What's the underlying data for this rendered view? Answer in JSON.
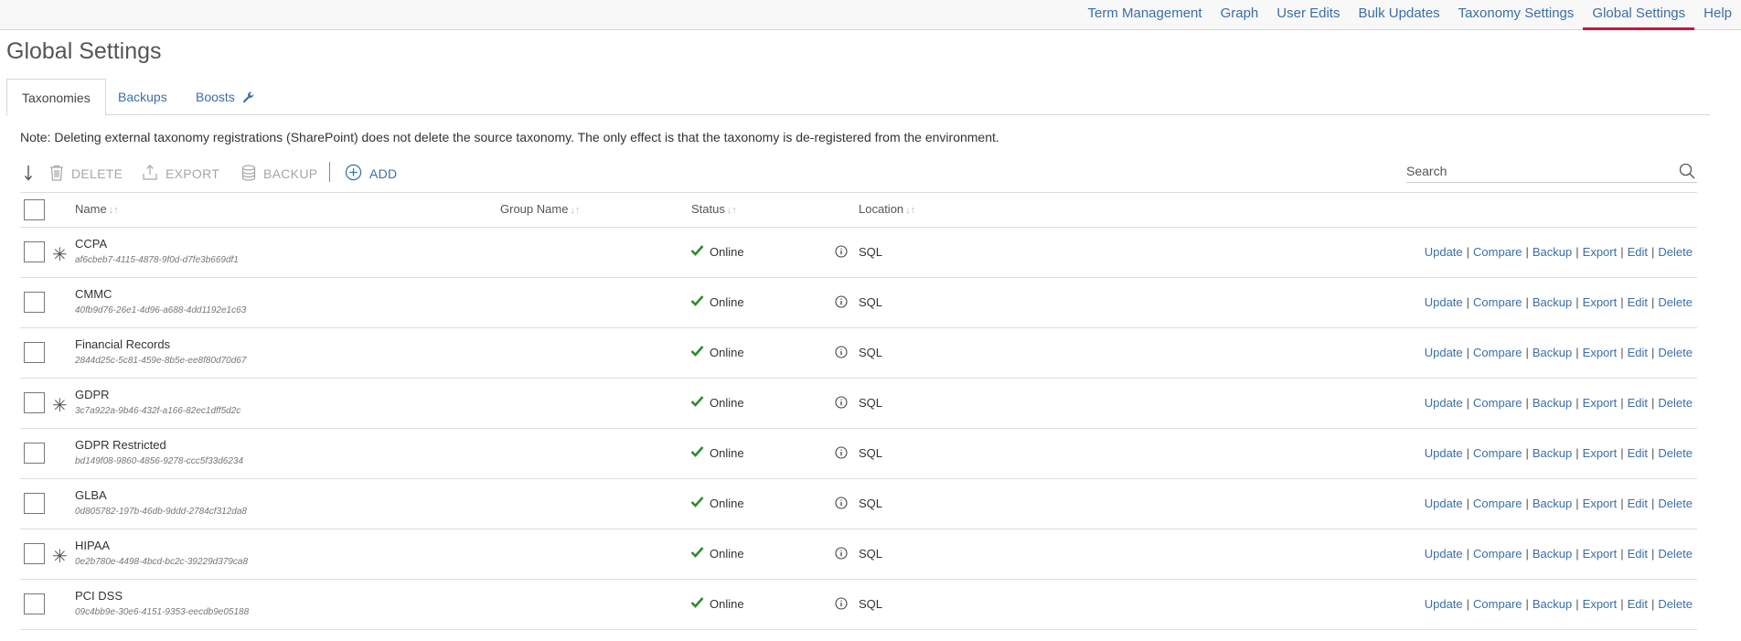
{
  "nav": {
    "items": [
      {
        "label": "Term Management",
        "active": false
      },
      {
        "label": "Graph",
        "active": false
      },
      {
        "label": "User Edits",
        "active": false
      },
      {
        "label": "Bulk Updates",
        "active": false
      },
      {
        "label": "Taxonomy Settings",
        "active": false
      },
      {
        "label": "Global Settings",
        "active": true
      },
      {
        "label": "Help",
        "active": false
      }
    ]
  },
  "page": {
    "title": "Global Settings"
  },
  "tabs": [
    {
      "label": "Taxonomies",
      "active": true
    },
    {
      "label": "Backups",
      "active": false
    },
    {
      "label": "Boosts",
      "active": false,
      "icon": "wrench-icon"
    }
  ],
  "note": "Note: Deleting external taxonomy registrations (SharePoint) does not delete the source taxonomy. The only effect is that the taxonomy is de-registered from the environment.",
  "toolbar": {
    "delete_label": "DELETE",
    "export_label": "EXPORT",
    "backup_label": "BACKUP",
    "add_label": "ADD"
  },
  "search": {
    "placeholder": "Search",
    "value": ""
  },
  "table": {
    "columns": {
      "name": "Name",
      "group": "Group Name",
      "status": "Status",
      "location": "Location"
    },
    "action_labels": [
      "Update",
      "Compare",
      "Backup",
      "Export",
      "Edit",
      "Delete"
    ],
    "rows": [
      {
        "name": "CCPA",
        "guid": "af6cbeb7-4115-4878-9f0d-d7fe3b669df1",
        "starred": true,
        "status": "Online",
        "location": "SQL"
      },
      {
        "name": "CMMC",
        "guid": "40fb9d76-26e1-4d96-a688-4dd1192e1c63",
        "starred": false,
        "status": "Online",
        "location": "SQL"
      },
      {
        "name": "Financial Records",
        "guid": "2844d25c-5c81-459e-8b5e-ee8f80d70d67",
        "starred": false,
        "status": "Online",
        "location": "SQL"
      },
      {
        "name": "GDPR",
        "guid": "3c7a922a-9b46-432f-a166-82ec1dff5d2c",
        "starred": true,
        "status": "Online",
        "location": "SQL"
      },
      {
        "name": "GDPR Restricted",
        "guid": "bd149f08-9860-4856-9278-ccc5f33d6234",
        "starred": false,
        "status": "Online",
        "location": "SQL"
      },
      {
        "name": "GLBA",
        "guid": "0d805782-197b-46db-9ddd-2784cf312da8",
        "starred": false,
        "status": "Online",
        "location": "SQL"
      },
      {
        "name": "HIPAA",
        "guid": "0e2b780e-4498-4bcd-bc2c-39229d379ca8",
        "starred": true,
        "status": "Online",
        "location": "SQL"
      },
      {
        "name": "PCI DSS",
        "guid": "09c4bb9e-30e6-4151-9353-eecdb9e05188",
        "starred": false,
        "status": "Online",
        "location": "SQL"
      }
    ]
  },
  "colors": {
    "link": "#3a6fa8",
    "active_underline": "#c8173a",
    "online_check": "#2e8b2e"
  }
}
